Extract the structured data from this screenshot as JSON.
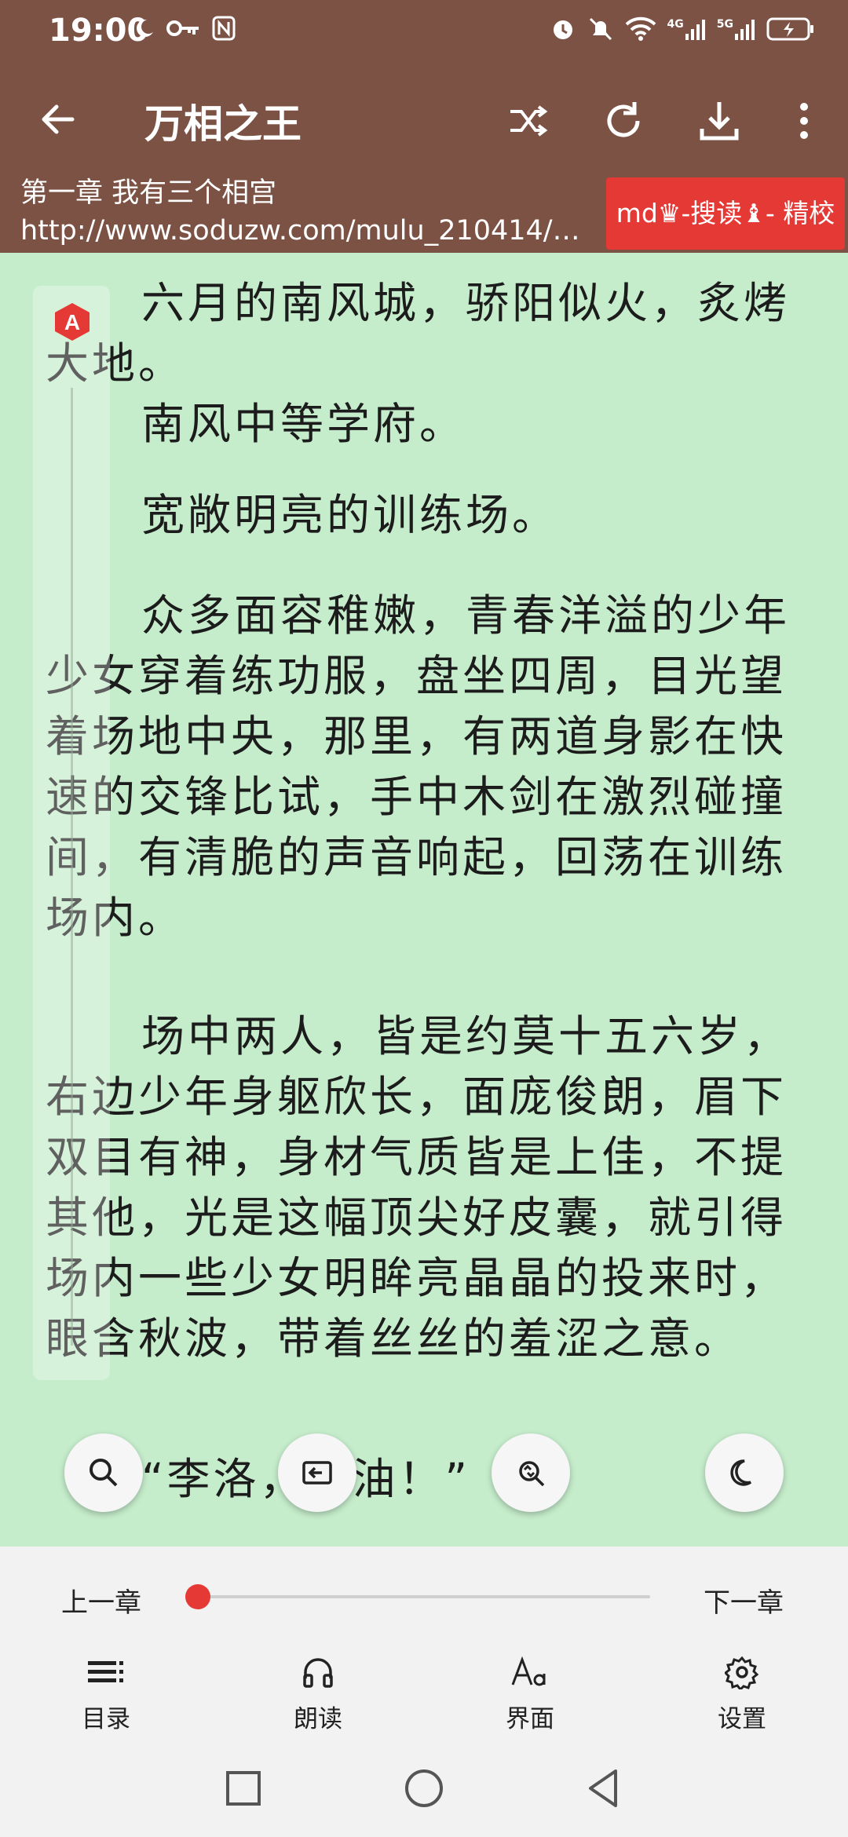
{
  "status_bar": {
    "time": "19:00",
    "left_icons": [
      "moon-icon",
      "key-icon",
      "nfc-icon"
    ],
    "right_icons": [
      "alarm-icon",
      "mute-icon",
      "wifi-icon",
      "signal-4g-icon",
      "signal-5g-icon",
      "battery-charging-icon"
    ],
    "net1": "4G",
    "net2": "5G"
  },
  "app_bar": {
    "title": "万相之王",
    "actions": [
      "shuffle-icon",
      "refresh-icon",
      "download-icon",
      "more-vert-icon"
    ]
  },
  "chapter": {
    "name": "第一章 我有三个相宫",
    "url": "http://www.soduzw.com/mulu_210414/47...",
    "source": "md♛-搜读♝- 精校"
  },
  "scroll_badge": "A",
  "paragraphs": [
    "六月的南风城，骄阳似火，炙烤大地。",
    "南风中等学府。",
    "宽敞明亮的训练场。",
    "众多面容稚嫩，青春洋溢的少年少女穿着练功服，盘坐四周，目光望着场地中央，那里，有两道身影在快速的交锋比试，手中木剑在激烈碰撞间，有清脆的声音响起，回荡在训练场内。",
    "场中两人，皆是约莫十五六岁，右边少年身躯欣长，面庞俊朗，眉下双目有神，身材气质皆是上佳，不提其他，光是这幅顶尖好皮囊，就引得场内一些少女明眸亮晶晶的投来时，眼含秋波，带着丝丝的羞涩之意。",
    "“李洛，加油！”"
  ],
  "floating_buttons": [
    "search-icon",
    "exit-fullscreen-icon",
    "sync-icon",
    "night-mode-icon"
  ],
  "progress": {
    "prev_label": "上一章",
    "next_label": "下一章",
    "value": 0
  },
  "bottom_nav": [
    {
      "label": "目录",
      "icon": "list-icon"
    },
    {
      "label": "朗读",
      "icon": "headphones-icon"
    },
    {
      "label": "界面",
      "icon": "font-icon"
    },
    {
      "label": "设置",
      "icon": "gear-icon"
    }
  ],
  "colors": {
    "app_bar": "#7b5244",
    "reading_bg": "#c5eccb",
    "accent_red": "#e53935"
  }
}
